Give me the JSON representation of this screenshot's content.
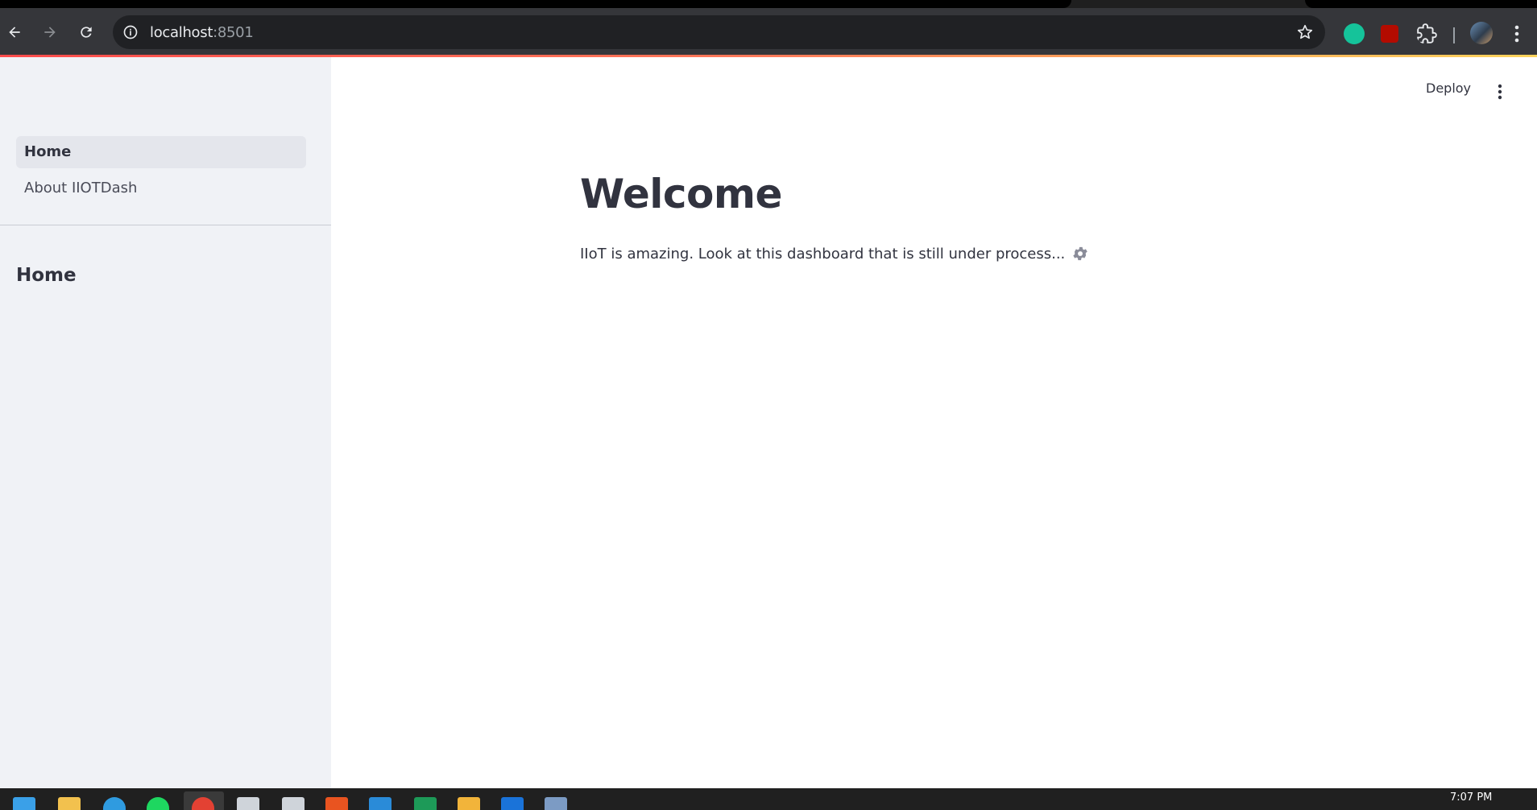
{
  "browser": {
    "url_host": "localhost",
    "url_port": ":8501",
    "icons": [
      "back-icon",
      "forward-icon",
      "reload-icon",
      "site-info-icon",
      "bookmark-star-icon",
      "grammarly-extension-icon",
      "adobe-extension-icon",
      "extensions-puzzle-icon",
      "profile-avatar",
      "chrome-menu-icon"
    ]
  },
  "sidebar": {
    "nav": [
      {
        "label": "Home",
        "active": true
      },
      {
        "label": "About IIOTDash",
        "active": false
      }
    ],
    "heading": "Home"
  },
  "header": {
    "deploy_label": "Deploy",
    "menu_icon": "kebab-menu-icon"
  },
  "main": {
    "title": "Welcome",
    "text": "IIoT is amazing. Look at this dashboard that is still under process...",
    "text_icon": "gear-icon"
  },
  "taskbar": {
    "clock": "7:07 PM",
    "apps": [
      "start-icon",
      "file-explorer-icon",
      "edge-icon",
      "spotify-icon",
      "chrome-icon",
      "files-icon",
      "files-icon-2",
      "ubuntu-icon",
      "vscode-icon",
      "excel-icon",
      "mail-icon",
      "outlook-icon",
      "postgres-icon"
    ]
  },
  "colors": {
    "accent_start": "#ff4b4b",
    "accent_end": "#fdd35b",
    "sidebar_bg": "#f0f2f6",
    "text": "#31333f"
  }
}
